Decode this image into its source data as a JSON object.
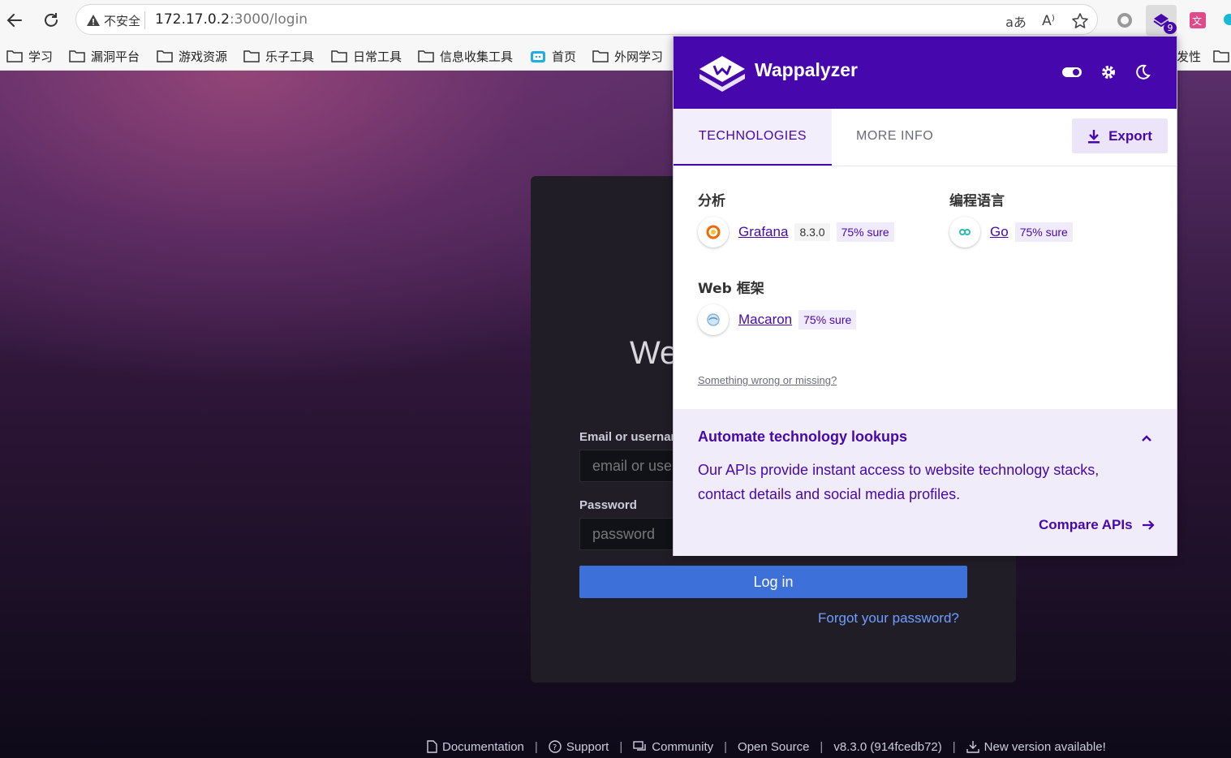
{
  "browser": {
    "address": {
      "security_label": "不安全",
      "host": "172.17.0.2",
      "path": ":3000/login"
    },
    "extension_badge": "9",
    "bookmarks": [
      {
        "label": "学习",
        "icon": "folder-icon"
      },
      {
        "label": "漏洞平台",
        "icon": "folder-icon"
      },
      {
        "label": "游戏资源",
        "icon": "folder-icon"
      },
      {
        "label": "乐子工具",
        "icon": "folder-icon"
      },
      {
        "label": "日常工具",
        "icon": "folder-icon"
      },
      {
        "label": "信息收集工具",
        "icon": "folder-icon"
      },
      {
        "label": "首页",
        "icon": "bilibili-icon"
      },
      {
        "label": "外网学习",
        "icon": "folder-icon"
      },
      {
        "label": "发性",
        "icon": "folder-icon"
      }
    ]
  },
  "login": {
    "welcome_partial": "We",
    "email_label_partial": "Email or usernam",
    "email_placeholder_partial": "email or user",
    "password_label": "Password",
    "password_placeholder": "password",
    "login_button": "Log in",
    "forgot_link": "Forgot your password?"
  },
  "footer": {
    "documentation": "Documentation",
    "support": "Support",
    "community": "Community",
    "open_source": "Open Source",
    "version": "v8.3.0 (914fcedb72)",
    "new_version": "New version available!",
    "separator": "|"
  },
  "wappalyzer": {
    "brand": "Wappalyzer",
    "tabs": {
      "technologies": "TECHNOLOGIES",
      "more_info": "MORE INFO"
    },
    "export_label": "Export",
    "categories": {
      "analytics": {
        "title": "分析",
        "tech": {
          "name": "Grafana",
          "version": "8.3.0",
          "confidence": "75% sure"
        }
      },
      "languages": {
        "title": "编程语言",
        "tech": {
          "name": "Go",
          "confidence": "75% sure"
        }
      },
      "web_frameworks": {
        "title": "Web 框架",
        "tech": {
          "name": "Macaron",
          "confidence": "75% sure"
        }
      }
    },
    "wrong_link": "Something wrong or missing?",
    "promo": {
      "title": "Automate technology lookups",
      "text": "Our APIs provide instant access to website technology stacks, contact details and social media profiles.",
      "cta": "Compare APIs"
    },
    "colors": {
      "brand": "#4608ad"
    }
  }
}
